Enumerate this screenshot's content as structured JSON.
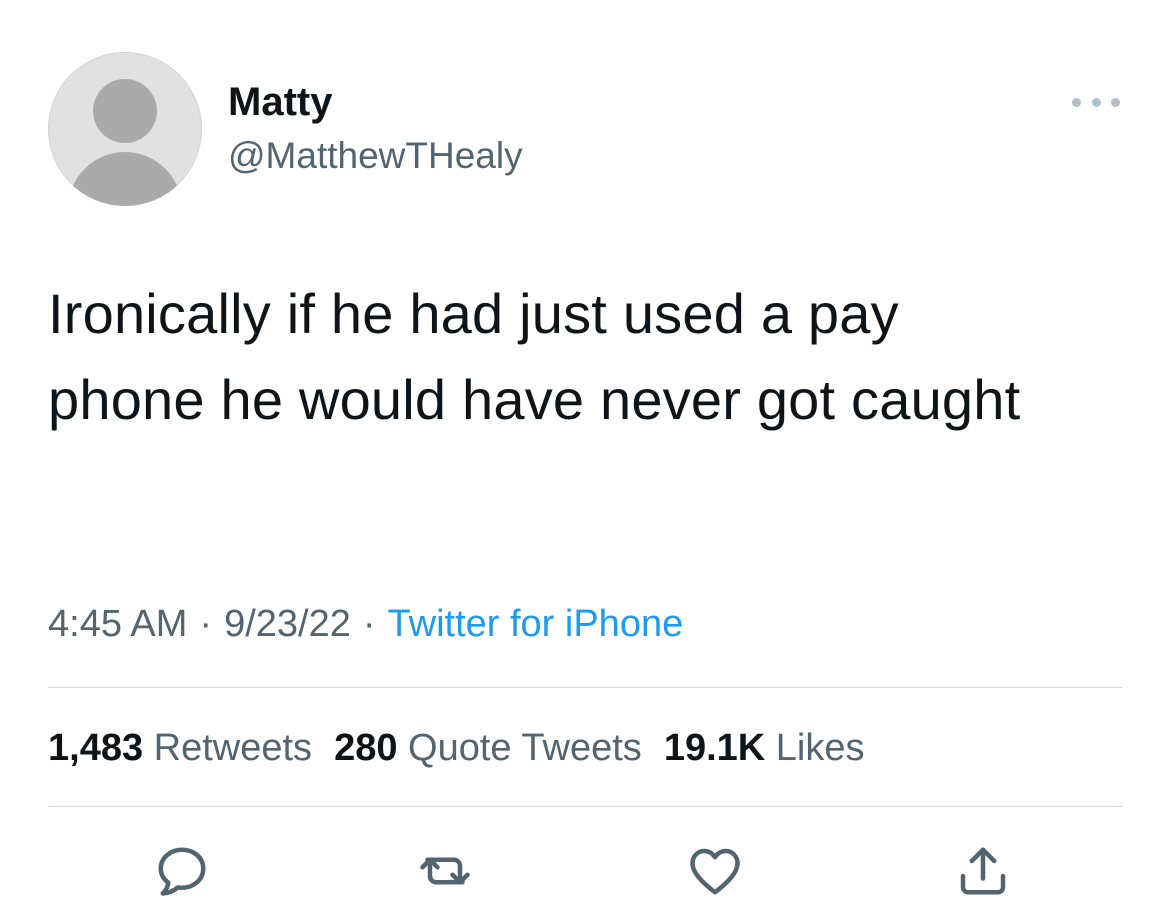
{
  "author": {
    "name": "Matty",
    "handle": "@MatthewTHealy"
  },
  "tweet": {
    "text": "Ironically if he had just used a pay phone he would have never got caught",
    "time": "4:45 AM",
    "date": "9/23/22",
    "source": "Twitter for iPhone",
    "separator": "·"
  },
  "stats": {
    "retweets_count": "1,483",
    "retweets_label": "Retweets",
    "quotes_count": "280",
    "quotes_label": "Quote Tweets",
    "likes_count": "19.1K",
    "likes_label": "Likes"
  },
  "actions": {
    "icons": [
      "reply-icon",
      "retweet-icon",
      "like-icon",
      "share-icon"
    ]
  },
  "colors": {
    "link": "#1d9bf0",
    "secondary_text": "#536471",
    "primary_text": "#0f1419",
    "divider": "#cfd9de"
  }
}
